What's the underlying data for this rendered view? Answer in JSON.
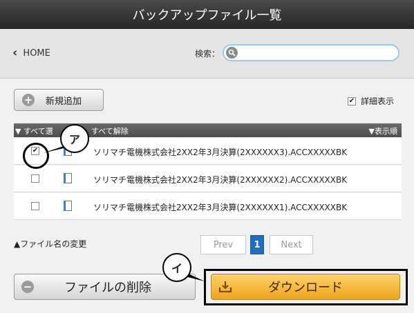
{
  "header": {
    "title": "バックアップファイル一覧"
  },
  "nav": {
    "home_label": "HOME",
    "search_label": "検索：",
    "search_value": "",
    "search_placeholder": ""
  },
  "toolbar": {
    "add_label": "新規追加",
    "detail_label": "詳細表示",
    "detail_checked": true
  },
  "list": {
    "select_all": "▼ すべて選",
    "clear_all": "すべて解除",
    "sort_label": "▼表示順",
    "files": [
      {
        "name": "ソリマチ電機株式会社2XX2年3月決算(2XXXXXX3).ACCXXXXXBK",
        "checked": true
      },
      {
        "name": "ソリマチ電機株式会社2XX2年3月決算(2XXXXXX2).ACCXXXXXBK",
        "checked": false
      },
      {
        "name": "ソリマチ電機株式会社2XX2年3月決算(2XXXXXX1).ACCXXXXXBK",
        "checked": false
      }
    ]
  },
  "footer": {
    "rename_label": "▲ファイル名の変更",
    "prev_label": "Prev",
    "current_page": "1",
    "next_label": "Next",
    "delete_label": "ファイルの削除",
    "download_label": "ダウンロード"
  },
  "callouts": {
    "a": "ア",
    "i": "イ"
  },
  "colors": {
    "accent_blue": "#1f6fbe",
    "download_orange": "#f0a418",
    "header_dark": "#333333"
  }
}
